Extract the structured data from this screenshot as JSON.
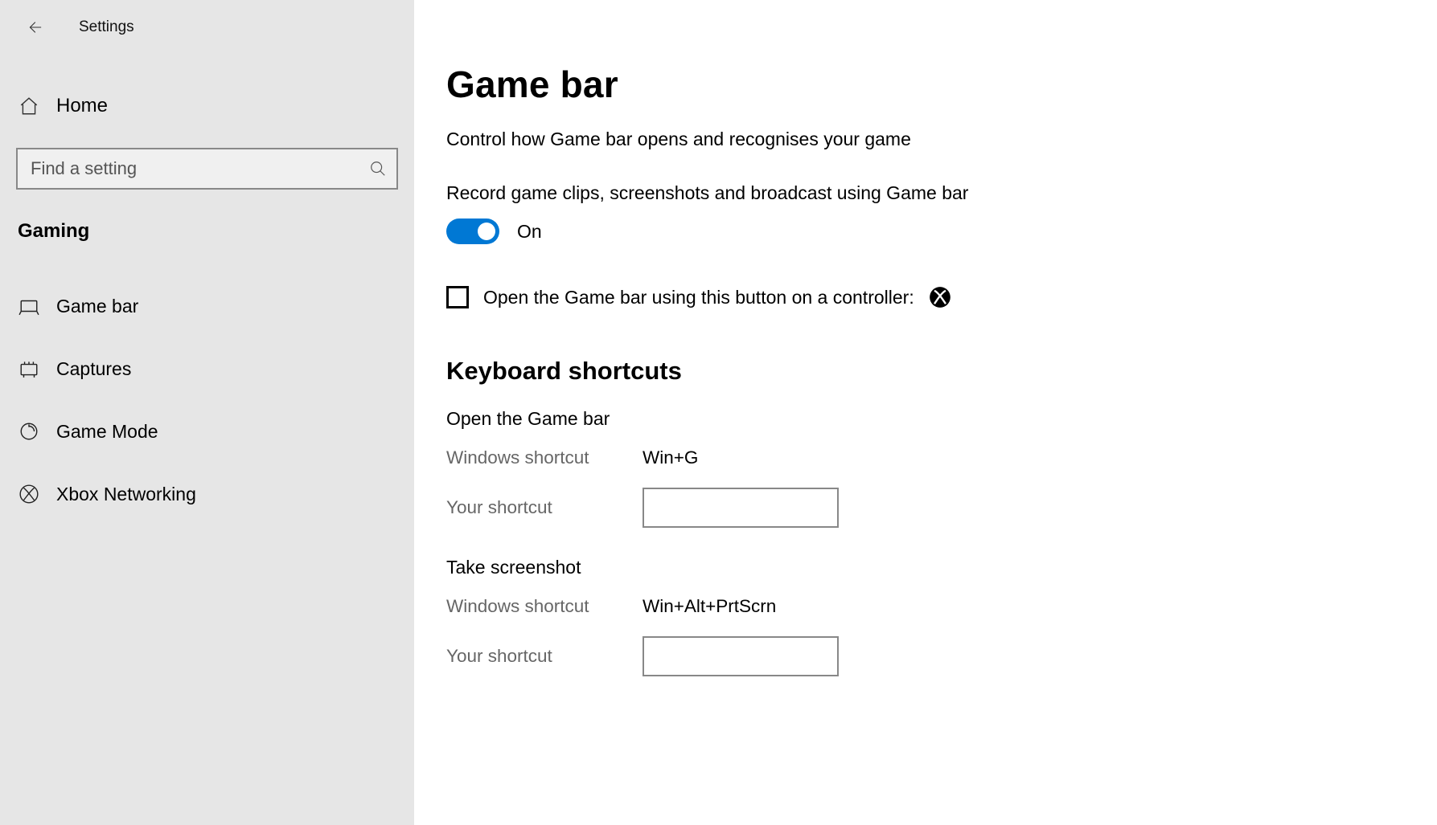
{
  "app_title": "Settings",
  "sidebar": {
    "home_label": "Home",
    "search_placeholder": "Find a setting",
    "category": "Gaming",
    "items": [
      {
        "label": "Game bar",
        "icon": "game-bar-icon"
      },
      {
        "label": "Captures",
        "icon": "captures-icon"
      },
      {
        "label": "Game Mode",
        "icon": "game-mode-icon"
      },
      {
        "label": "Xbox Networking",
        "icon": "xbox-networking-icon"
      }
    ]
  },
  "main": {
    "title": "Game bar",
    "subtitle": "Control how Game bar opens and recognises your game",
    "record_toggle": {
      "label": "Record game clips, screenshots and broadcast using Game bar",
      "state_label": "On",
      "on": true
    },
    "controller_checkbox": {
      "label": "Open the Game bar using this button on a controller:",
      "checked": false
    },
    "shortcuts_heading": "Keyboard shortcuts",
    "shortcuts_labels": {
      "windows_shortcut": "Windows shortcut",
      "your_shortcut": "Your shortcut"
    },
    "shortcuts": [
      {
        "title": "Open the Game bar",
        "windows_value": "Win+G",
        "user_value": ""
      },
      {
        "title": "Take screenshot",
        "windows_value": "Win+Alt+PrtScrn",
        "user_value": ""
      }
    ]
  }
}
